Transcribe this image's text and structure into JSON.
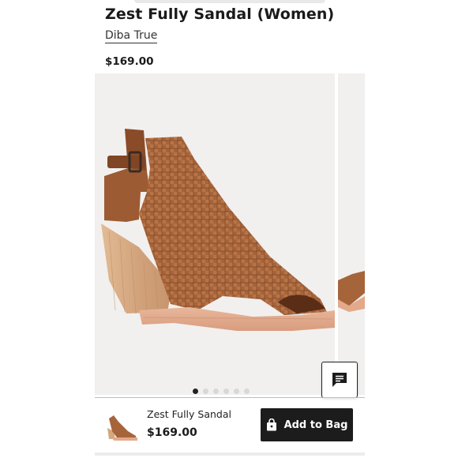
{
  "product": {
    "title": "Zest Fully Sandal (Women)",
    "brand": "Diba True",
    "price": "$169.00"
  },
  "gallery": {
    "image": "tan-woven-leather-peep-toe-bootie",
    "total_slides": 6,
    "active_slide": 1
  },
  "chat": {
    "icon": "chat-icon"
  },
  "bottom_bar": {
    "name": "Zest Fully Sandal",
    "price": "$169.00",
    "add_label": "Add to Bag",
    "bag_icon": "shopping-bag-icon"
  },
  "colors": {
    "leather": "#a8643a",
    "heel_wood": "#d9b08c",
    "button_bg": "#1c1c1c",
    "image_bg": "#f1f0ef"
  }
}
